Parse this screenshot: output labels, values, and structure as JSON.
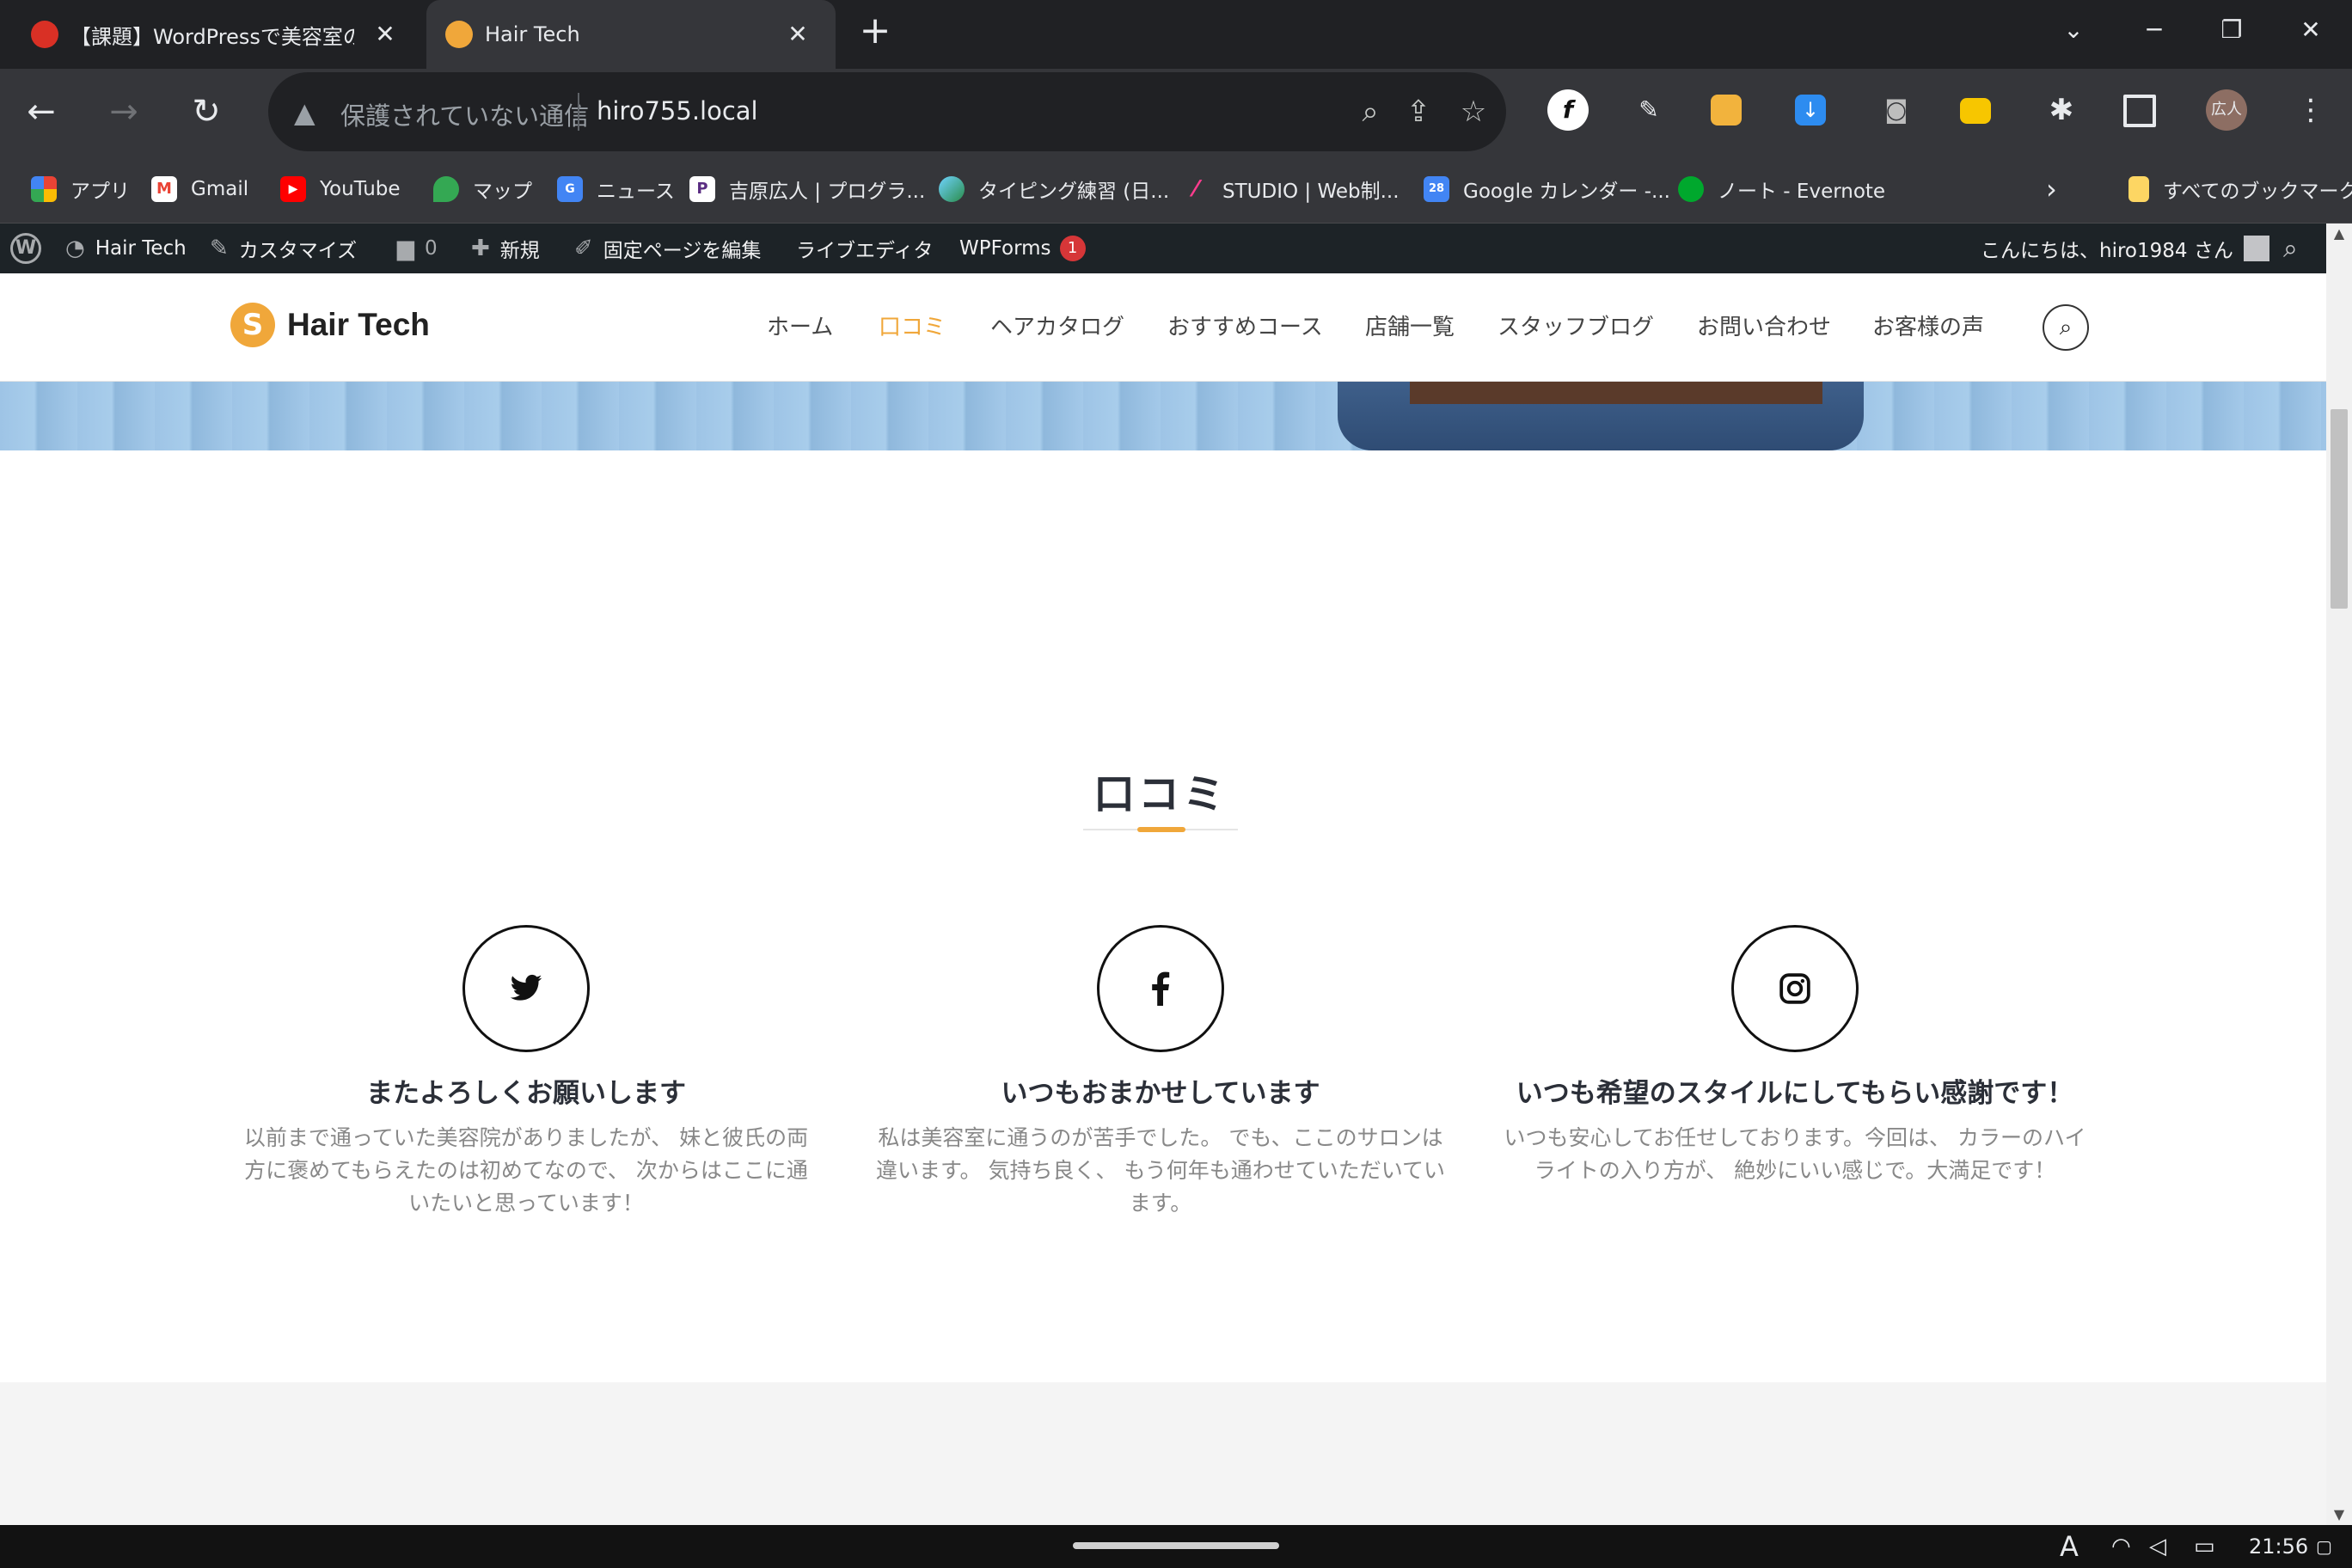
{
  "browser": {
    "tabs": [
      {
        "title": "【課題】WordPressで美容室のサ",
        "active": false
      },
      {
        "title": "Hair Tech",
        "active": true
      }
    ],
    "new_tab": "+",
    "omnibox": {
      "security": "保護されていない通信",
      "url": "hiro755.local"
    },
    "profile_label": "広人",
    "bookmarks": [
      {
        "label": "アプリ",
        "icon": "apps-grid-icon"
      },
      {
        "label": "Gmail",
        "icon": "gmail-icon"
      },
      {
        "label": "YouTube",
        "icon": "youtube-icon"
      },
      {
        "label": "マップ",
        "icon": "maps-icon"
      },
      {
        "label": "ニュース",
        "icon": "news-icon"
      },
      {
        "label": "吉原広人 | プログラ...",
        "icon": "p-icon"
      },
      {
        "label": "タイピング練習 (日...",
        "icon": "typing-icon"
      },
      {
        "label": "STUDIO | Web制...",
        "icon": "studio-icon"
      },
      {
        "label": "Google カレンダー -...",
        "icon": "calendar-icon"
      },
      {
        "label": "ノート - Evernote",
        "icon": "evernote-icon"
      }
    ],
    "all_bookmarks": "すべてのブックマーク"
  },
  "wp_admin": {
    "site": "Hair Tech",
    "customize": "カスタマイズ",
    "comments": "0",
    "new": "新規",
    "edit_page": "固定ページを編集",
    "live_editor": "ライブエディタ",
    "wpforms": "WPForms",
    "wpforms_badge": "1",
    "greeting": "こんにちは、hiro1984 さん"
  },
  "site": {
    "logo_mark": "S",
    "logo_text": "Hair Tech",
    "nav": [
      "ホーム",
      "口コミ",
      "ヘアカタログ",
      "おすすめコース",
      "店舗一覧",
      "スタッフブログ",
      "お問い合わせ",
      "お客様の声"
    ],
    "nav_active_index": 1,
    "accent_color": "#f0a73a",
    "section_title": "口コミ",
    "reviews": [
      {
        "icon": "twitter-icon",
        "heading": "またよろしくお願いします",
        "text": "以前まで通っていた美容院がありましたが、 妹と彼氏の両方に褒めてもらえたのは初めてなので、 次からはここに通いたいと思っています！"
      },
      {
        "icon": "facebook-icon",
        "heading": "いつもおまかせしています",
        "text": "私は美容室に通うのが苦手でした。 でも、ここのサロンは違います。 気持ち良く、 もう何年も通わせていただいています。"
      },
      {
        "icon": "instagram-icon",
        "heading": "いつも希望のスタイルにしてもらい感謝です！",
        "text": "いつも安心してお任せしております。今回は、 カラーのハイライトの入り方が、 絶妙にいい感じで。大満足です！"
      }
    ]
  },
  "taskbar": {
    "ime": "A",
    "time": "21:56"
  }
}
